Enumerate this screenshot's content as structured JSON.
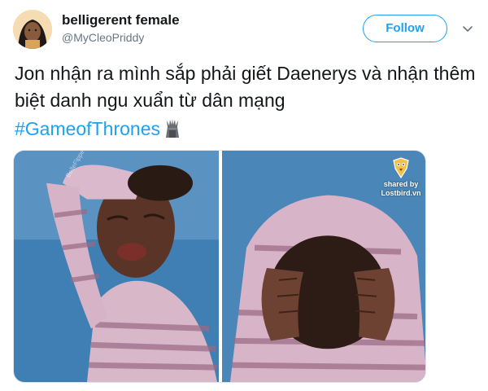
{
  "user": {
    "display_name": "belligerent female",
    "handle": "@MyCleoPriddy"
  },
  "actions": {
    "follow_label": "Follow"
  },
  "tweet": {
    "text": "Jon nhận ra mình sắp phải giết Daenerys và nhận thêm biệt danh ngu xuẩn từ dân mạng",
    "hashtag": "#GameofThrones"
  },
  "media": {
    "watermark_line1": "shared by",
    "watermark_line2": "Lostbird.vn",
    "photo_watermark": "BelleFippedz"
  },
  "colors": {
    "accent": "#1da1f2",
    "handle_gray": "#657786",
    "photo_bg": "#4a86b8"
  },
  "icons": {
    "caret": "chevron-down-icon",
    "emoji": "iron-throne-icon",
    "logo": "lostbird-logo-icon"
  }
}
